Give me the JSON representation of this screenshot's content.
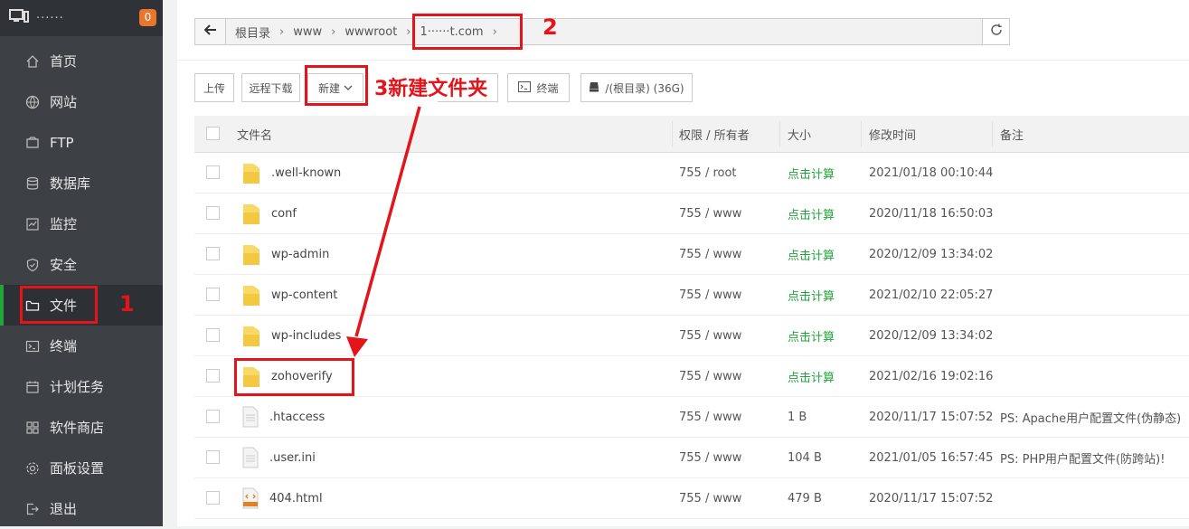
{
  "sidebar": {
    "site_title": "······",
    "badge": "0",
    "items": [
      {
        "label": "首页",
        "icon": "home-icon"
      },
      {
        "label": "网站",
        "icon": "globe-icon"
      },
      {
        "label": "FTP",
        "icon": "ftp-icon"
      },
      {
        "label": "数据库",
        "icon": "database-icon"
      },
      {
        "label": "监控",
        "icon": "monitor-icon"
      },
      {
        "label": "安全",
        "icon": "shield-icon"
      },
      {
        "label": "文件",
        "icon": "folder-icon",
        "active": true
      },
      {
        "label": "终端",
        "icon": "terminal-icon"
      },
      {
        "label": "计划任务",
        "icon": "calendar-icon"
      },
      {
        "label": "软件商店",
        "icon": "grid-icon"
      },
      {
        "label": "面板设置",
        "icon": "settings-icon"
      },
      {
        "label": "退出",
        "icon": "logout-icon"
      }
    ]
  },
  "path": {
    "crumbs": [
      "根目录",
      "www",
      "wwwroot",
      "1······t.com"
    ]
  },
  "toolbar": {
    "upload": "上传",
    "remote_download": "远程下载",
    "new": "新建",
    "terminal": "终端",
    "disk": "/(根目录) (36G)"
  },
  "table": {
    "headers": {
      "name": "文件名",
      "perm": "权限 / 所有者",
      "size": "大小",
      "mtime": "修改时间",
      "note": "备注"
    },
    "rows": [
      {
        "type": "folder",
        "name": ".well-known",
        "perm": "755 / root",
        "size": "点击计算",
        "mtime": "2021/01/18 00:10:44",
        "note": ""
      },
      {
        "type": "folder",
        "name": "conf",
        "perm": "755 / www",
        "size": "点击计算",
        "mtime": "2020/11/18 16:50:03",
        "note": ""
      },
      {
        "type": "folder",
        "name": "wp-admin",
        "perm": "755 / www",
        "size": "点击计算",
        "mtime": "2020/12/09 13:34:02",
        "note": ""
      },
      {
        "type": "folder",
        "name": "wp-content",
        "perm": "755 / www",
        "size": "点击计算",
        "mtime": "2021/02/10 22:05:27",
        "note": ""
      },
      {
        "type": "folder",
        "name": "wp-includes",
        "perm": "755 / www",
        "size": "点击计算",
        "mtime": "2020/12/09 13:34:02",
        "note": ""
      },
      {
        "type": "folder",
        "name": "zohoverify",
        "perm": "755 / www",
        "size": "点击计算",
        "mtime": "2021/02/16 19:02:16",
        "note": ""
      },
      {
        "type": "file",
        "name": ".htaccess",
        "perm": "755 / www",
        "size": "1 B",
        "mtime": "2020/11/17 15:07:52",
        "note": "PS: Apache用户配置文件(伪静态)"
      },
      {
        "type": "file",
        "name": ".user.ini",
        "perm": "755 / www",
        "size": "104 B",
        "mtime": "2021/01/05 16:57:45",
        "note": "PS: PHP用户配置文件(防跨站)!"
      },
      {
        "type": "html",
        "name": "404.html",
        "perm": "755 / www",
        "size": "479 B",
        "mtime": "2020/11/17 15:07:52",
        "note": ""
      }
    ]
  },
  "annotations": {
    "n1": "1",
    "n2": "2",
    "n3": "3新建文件夹",
    "color": "#e4141b"
  }
}
